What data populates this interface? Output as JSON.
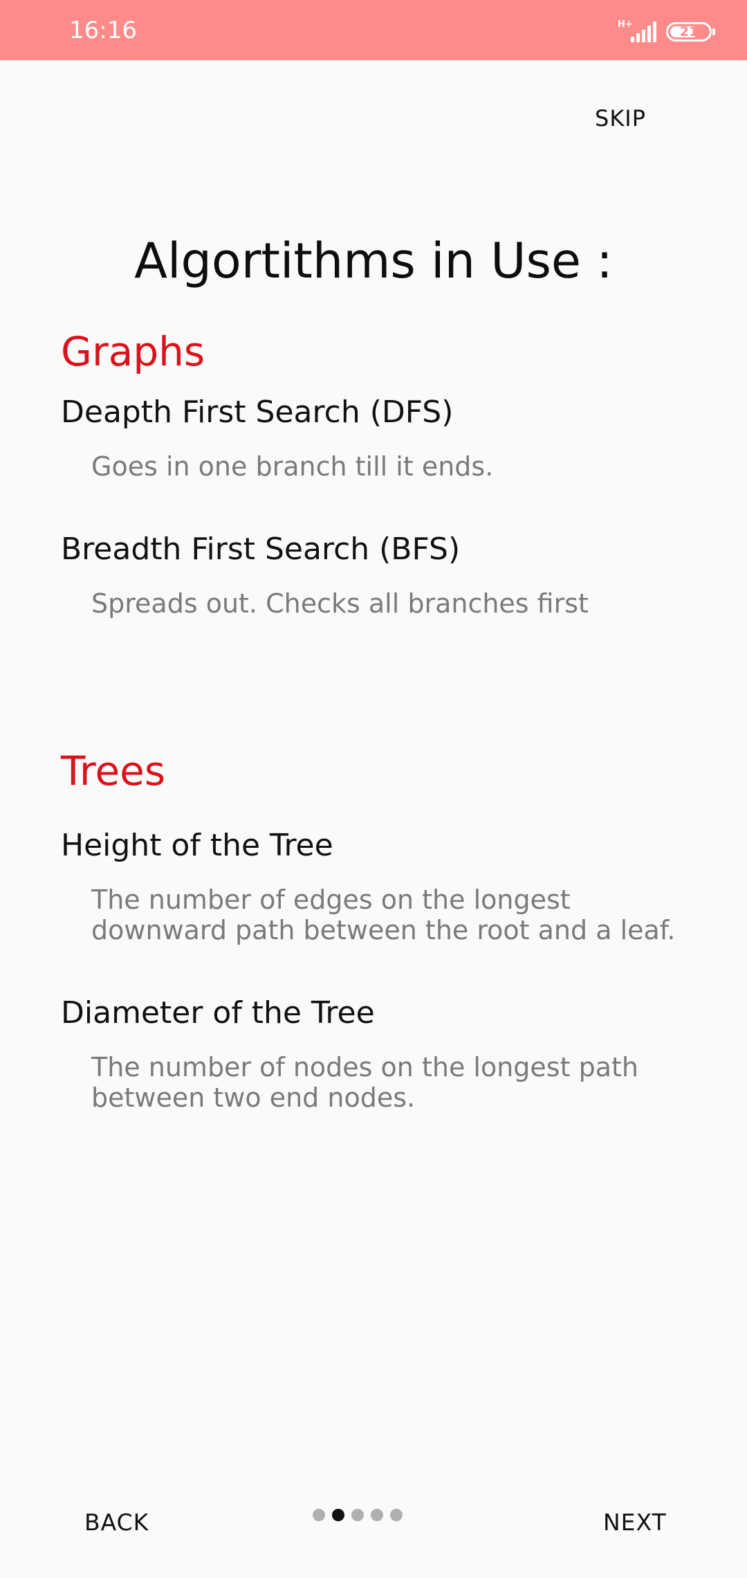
{
  "status_bar": {
    "time": "16:16",
    "network_type": "H+",
    "battery_level": "21"
  },
  "header": {
    "skip_label": "SKIP"
  },
  "page": {
    "title": "Algortithms in Use :"
  },
  "sections": [
    {
      "heading": "Graphs",
      "items": [
        {
          "title": "Deapth First Search (DFS)",
          "description": "Goes in one branch till it ends."
        },
        {
          "title": "Breadth First Search (BFS)",
          "description": "Spreads out. Checks all branches first"
        }
      ]
    },
    {
      "heading": "Trees",
      "items": [
        {
          "title": "Height of the Tree",
          "description": "The number of edges on the longest downward path between the root and a leaf."
        },
        {
          "title": "Diameter of the Tree",
          "description": "The number of nodes on the longest path between two end nodes."
        }
      ]
    }
  ],
  "footer": {
    "back_label": "BACK",
    "next_label": "NEXT",
    "page_indicator": {
      "total": 5,
      "current": 2
    }
  },
  "colors": {
    "status_bar": "#ff8a8a",
    "section_heading": "#d9121b",
    "description_text": "#7a7a7a",
    "background": "#fafafa"
  }
}
